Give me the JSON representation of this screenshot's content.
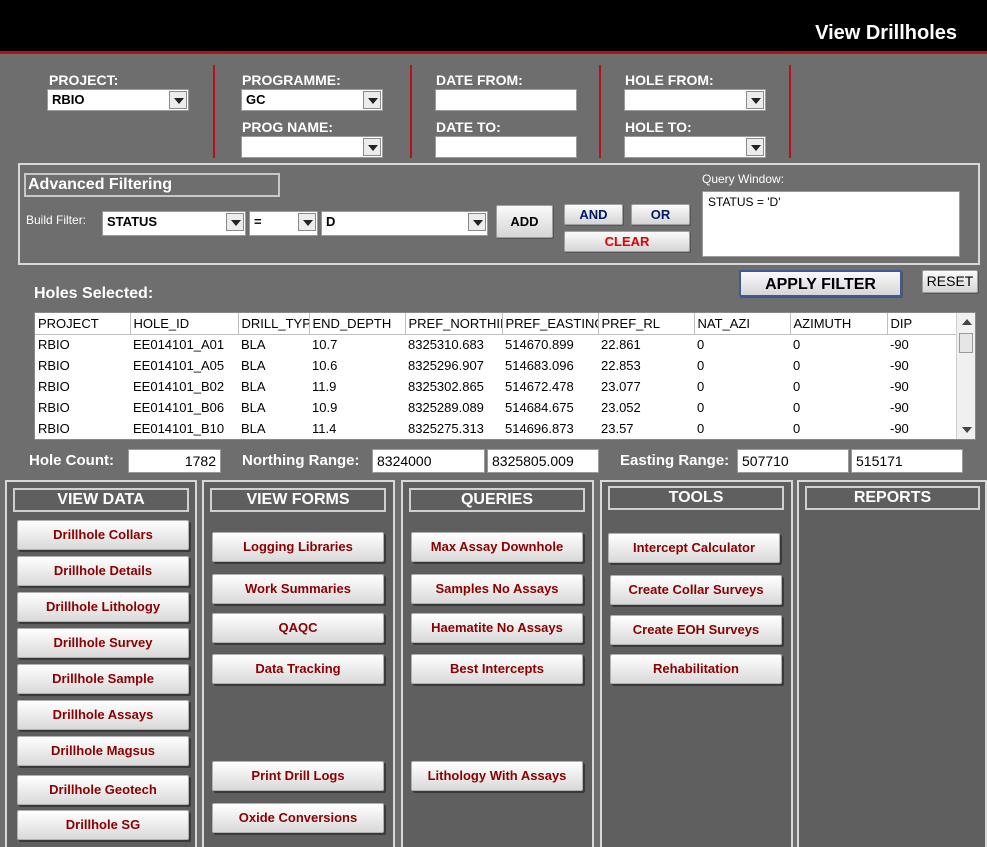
{
  "window": {
    "title": "View Drillholes"
  },
  "filters": {
    "project_label": "PROJECT:",
    "project_value": "RBIO",
    "programme_label": "PROGRAMME:",
    "programme_value": "GC",
    "prog_name_label": "PROG NAME:",
    "prog_name_value": "",
    "date_from_label": "DATE FROM:",
    "date_to_label": "DATE TO:",
    "hole_from_label": "HOLE FROM:",
    "hole_to_label": "HOLE TO:"
  },
  "advanced": {
    "title": "Advanced Filtering",
    "build_filter_label": "Build Filter:",
    "field": "STATUS",
    "operator": "=",
    "value": "D",
    "add_label": "ADD",
    "and_label": "AND",
    "or_label": "OR",
    "clear_label": "CLEAR",
    "query_window_label": "Query Window:",
    "query_text": "STATUS = 'D'",
    "apply_label": "APPLY FILTER",
    "reset_label": "RESET"
  },
  "holes": {
    "label": "Holes Selected:",
    "columns": [
      "PROJECT",
      "HOLE_ID",
      "DRILL_TYP",
      "END_DEPTH",
      "PREF_NORTHII",
      "PREF_EASTING",
      "PREF_RL",
      "NAT_AZI",
      "AZIMUTH",
      "DIP"
    ],
    "rows": [
      [
        "RBIO",
        "EE014101_A01",
        "BLA",
        "10.7",
        "8325310.683",
        "514670.899",
        "22.861",
        "0",
        "0",
        "-90"
      ],
      [
        "RBIO",
        "EE014101_A05",
        "BLA",
        "10.6",
        "8325296.907",
        "514683.096",
        "22.853",
        "0",
        "0",
        "-90"
      ],
      [
        "RBIO",
        "EE014101_B02",
        "BLA",
        "11.9",
        "8325302.865",
        "514672.478",
        "23.077",
        "0",
        "0",
        "-90"
      ],
      [
        "RBIO",
        "EE014101_B06",
        "BLA",
        "10.9",
        "8325289.089",
        "514684.675",
        "23.052",
        "0",
        "0",
        "-90"
      ],
      [
        "RBIO",
        "EE014101_B10",
        "BLA",
        "11.4",
        "8325275.313",
        "514696.873",
        "23.57",
        "0",
        "0",
        "-90"
      ]
    ]
  },
  "summary": {
    "hole_count_label": "Hole Count:",
    "hole_count": "1782",
    "northing_label": "Northing Range:",
    "northing_min": "8324000",
    "northing_max": "8325805.009",
    "easting_label": "Easting Range:",
    "easting_min": "507710",
    "easting_max": "515171"
  },
  "panels": {
    "view_data": {
      "title": "VIEW DATA",
      "buttons": [
        "Drillhole Collars",
        "Drillhole Details",
        "Drillhole Lithology",
        "Drillhole Survey",
        "Drillhole Sample",
        "Drillhole Assays",
        "Drillhole Magsus",
        "Drillhole Geotech",
        "Drillhole SG"
      ]
    },
    "view_forms": {
      "title": "VIEW FORMS",
      "buttons": [
        "Logging Libraries",
        "Work Summaries",
        "QAQC",
        "Data Tracking",
        "Print Drill Logs",
        "Oxide Conversions"
      ]
    },
    "queries": {
      "title": "QUERIES",
      "buttons": [
        "Max Assay Downhole",
        "Samples No Assays",
        "Haematite No Assays",
        "Best Intercepts",
        "Lithology With Assays"
      ]
    },
    "tools": {
      "title": "TOOLS",
      "buttons": [
        "Intercept Calculator",
        "Create Collar Surveys",
        "Create EOH Surveys",
        "Rehabilitation"
      ]
    },
    "reports": {
      "title": "REPORTS"
    }
  },
  "colors": {
    "accent": "#b3121a",
    "button_text": "#8b0000",
    "background": "#6e6e6e"
  }
}
